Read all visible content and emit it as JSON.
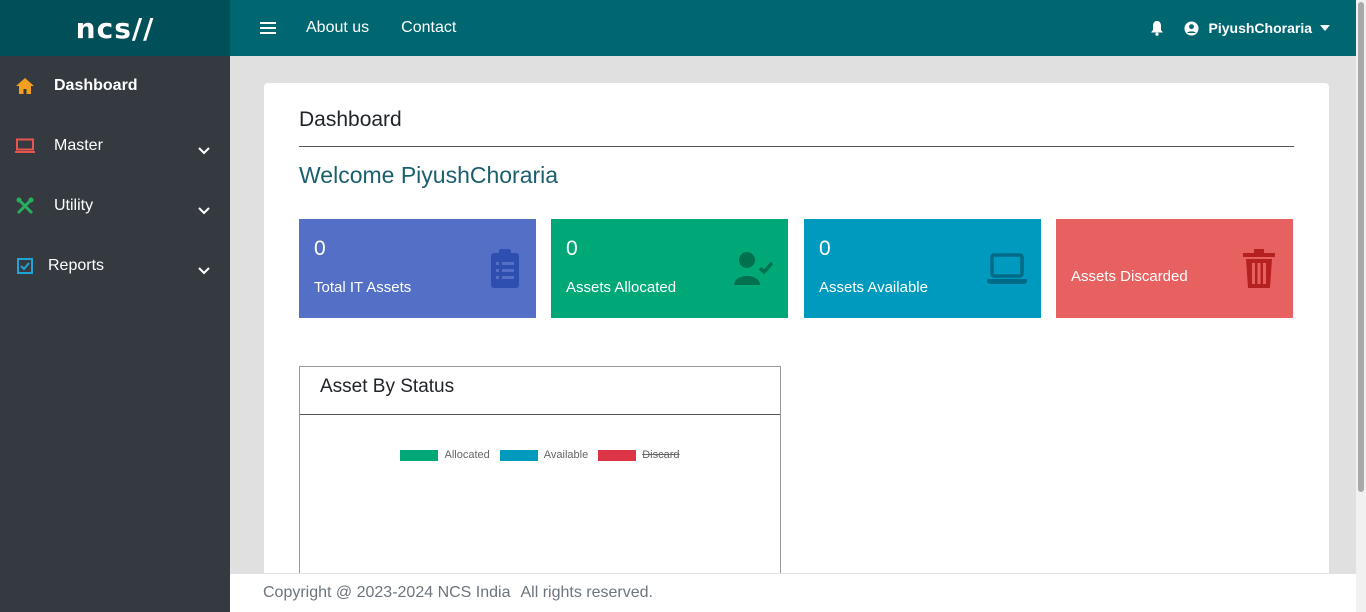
{
  "brand": {
    "logo_text": "ncs//"
  },
  "sidebar": {
    "items": [
      {
        "label": "Dashboard",
        "icon": "home-icon",
        "color": "#f0a01e",
        "active": true
      },
      {
        "label": "Master",
        "icon": "laptop-icon",
        "color": "#e8554e",
        "expandable": true
      },
      {
        "label": "Utility",
        "icon": "tools-icon",
        "color": "#27ae60",
        "expandable": true
      },
      {
        "label": "Reports",
        "icon": "checkbox-icon",
        "color": "#1ea5d6",
        "expandable": true
      }
    ]
  },
  "topbar": {
    "links": [
      "About us",
      "Contact"
    ],
    "user_name": "PiyushChoraria"
  },
  "main": {
    "page_title": "Dashboard",
    "welcome": "Welcome PiyushChoraria",
    "tiles": [
      {
        "value": "0",
        "label": "Total IT Assets",
        "color": "#5470c6",
        "icon": "clipboard-icon"
      },
      {
        "value": "0",
        "label": "Assets Allocated",
        "color": "#00a878",
        "icon": "user-check-icon"
      },
      {
        "value": "0",
        "label": "Assets Available",
        "color": "#009abf",
        "icon": "laptop-icon"
      },
      {
        "value": "",
        "label": "Assets Discarded",
        "color": "#e86161",
        "icon": "trash-icon"
      }
    ],
    "status_panel": {
      "title": "Asset By Status",
      "chart_data": {
        "type": "bar",
        "series": [
          {
            "name": "Allocated",
            "color": "#00a878",
            "hidden": false,
            "values": []
          },
          {
            "name": "Available",
            "color": "#009abf",
            "hidden": false,
            "values": []
          },
          {
            "name": "Discard",
            "color": "#dc3545",
            "hidden": true,
            "values": []
          }
        ]
      }
    }
  },
  "footer": {
    "copyright": "Copyright @ 2023-2024 NCS India",
    "rights": "All rights reserved."
  }
}
